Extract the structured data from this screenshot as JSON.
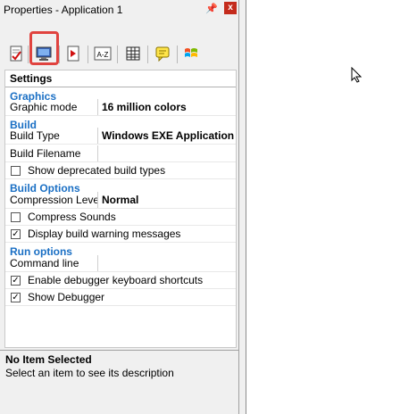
{
  "window": {
    "title": "Properties - Application 1",
    "pin_icon": "pin-icon",
    "close_icon": "close-icon",
    "close_label": "x"
  },
  "toolbar": {
    "buttons": [
      {
        "name": "properties-icon"
      },
      {
        "name": "graphics-monitor-icon",
        "selected": true
      },
      {
        "name": "build-icon"
      },
      {
        "name": "sort-az-icon"
      },
      {
        "name": "grid-icon"
      },
      {
        "name": "comment-icon"
      },
      {
        "name": "windows-logo-icon"
      }
    ],
    "sort_label": "A-Z"
  },
  "settings": {
    "header": "Settings",
    "sections": [
      {
        "category": "Graphics",
        "rows": [
          {
            "type": "prop",
            "name": "Graphic mode",
            "value": "16 million colors"
          }
        ]
      },
      {
        "category": "Build",
        "rows": [
          {
            "type": "prop",
            "name": "Build Type",
            "value": "Windows EXE Application"
          },
          {
            "type": "prop",
            "name": "Build Filename",
            "value": ""
          },
          {
            "type": "check",
            "label": "Show deprecated build types",
            "checked": false
          }
        ]
      },
      {
        "category": "Build Options",
        "rows": [
          {
            "type": "prop",
            "name": "Compression Level",
            "value": "Normal"
          },
          {
            "type": "check",
            "label": "Compress Sounds",
            "checked": false
          },
          {
            "type": "check",
            "label": "Display build warning messages",
            "checked": true
          }
        ]
      },
      {
        "category": "Run options",
        "rows": [
          {
            "type": "prop",
            "name": "Command line",
            "value": ""
          },
          {
            "type": "check",
            "label": "Enable debugger keyboard shortcuts",
            "checked": true
          },
          {
            "type": "check",
            "label": "Show Debugger",
            "checked": true
          }
        ]
      }
    ]
  },
  "description": {
    "title": "No Item Selected",
    "text": "Select an item to see its description"
  },
  "colors": {
    "category": "#1a6fc4",
    "highlight": "#e0433f",
    "close": "#c42b1c"
  }
}
